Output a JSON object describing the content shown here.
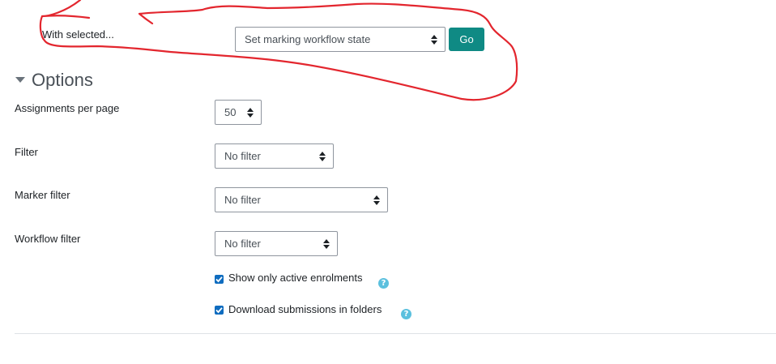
{
  "bulk_action": {
    "label": "With selected...",
    "select_value": "Set marking workflow state",
    "go_button": "Go"
  },
  "options": {
    "heading": "Options",
    "assignments_per_page": {
      "label": "Assignments per page",
      "value": "50"
    },
    "filter": {
      "label": "Filter",
      "value": "No filter"
    },
    "marker_filter": {
      "label": "Marker filter",
      "value": "No filter"
    },
    "workflow_filter": {
      "label": "Workflow filter",
      "value": "No filter"
    },
    "active_enrolments": {
      "label": "Show only active enrolments",
      "checked": true
    },
    "download_folders": {
      "label": "Download submissions in folders",
      "checked": true
    }
  },
  "colors": {
    "accent": "#0f6cbf",
    "go_button": "#0f8a84",
    "help_icon": "#5bc0de",
    "annotation": "#e3262e"
  }
}
